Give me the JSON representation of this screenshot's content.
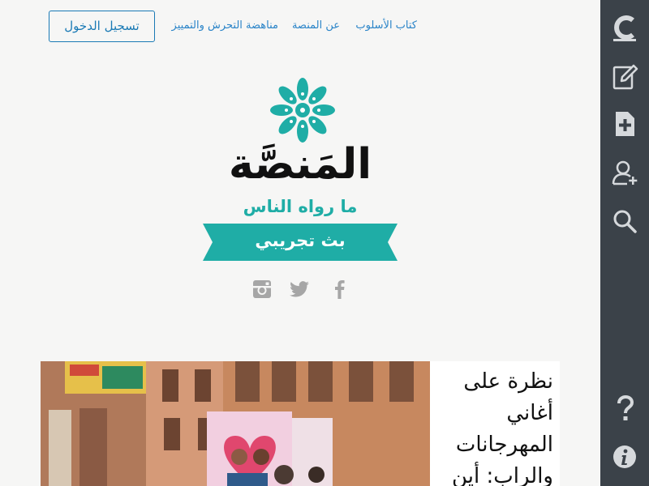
{
  "nav": {
    "login_label": "تسجيل الدخول",
    "links": [
      "كتاب الأسلوب",
      "عن المنصة",
      "مناهضة التحرش والتمييز"
    ]
  },
  "logo": {
    "title": "المَنصَّة",
    "subtitle": "ما رواه الناس",
    "ribbon": "بث تجريبي",
    "accent_color": "#1fada6"
  },
  "social": {
    "icons": [
      "instagram-icon",
      "twitter-icon",
      "facebook-icon"
    ]
  },
  "article": {
    "title": "نظرة على أغاني المهرجانات والراب: أين"
  },
  "sidebar": {
    "icons": [
      "medium-logo-icon",
      "write-icon",
      "new-document-icon",
      "add-user-icon",
      "search-icon",
      "help-icon",
      "info-icon"
    ],
    "background": "#3b4249"
  }
}
